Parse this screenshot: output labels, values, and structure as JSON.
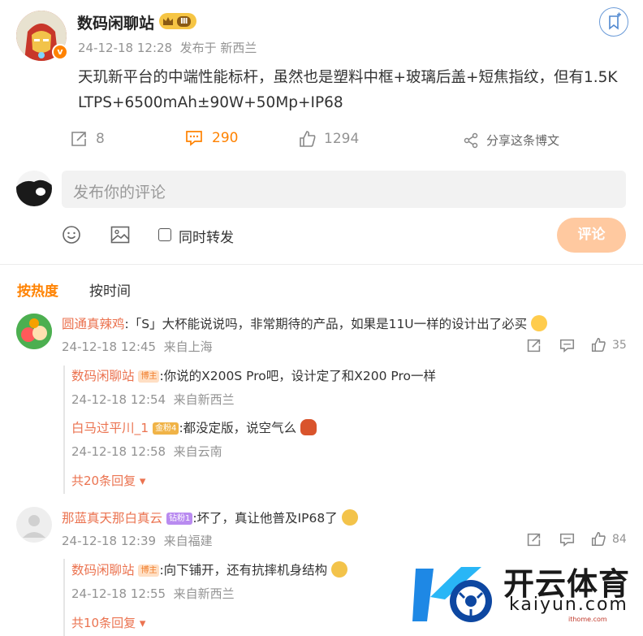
{
  "post": {
    "author": "数码闲聊站",
    "level_badge": "Ⅲ",
    "verified_mark": "v",
    "time": "24-12-18 12:28",
    "source": "发布于 新西兰",
    "content_line1": "天玑新平台的中端性能标杆，虽然也是塑料中框+玻璃后盖+短焦指纹，但有1.5K",
    "content_line2": "LTPS+6500mAh±90W+50Mp+IP68",
    "repost_count": "8",
    "comment_count": "290",
    "like_count": "1294",
    "share_label": "分享这条博文"
  },
  "composer": {
    "placeholder": "发布你的评论",
    "repost_label": "同时转发",
    "submit_label": "评论"
  },
  "sort_tabs": {
    "hot": "按热度",
    "time": "按时间"
  },
  "comments": [
    {
      "user": "圆通真辣鸡",
      "text": ":「S」大杯能说说吗，非常期待的产品，如果是11U一样的设计出了必买",
      "time": "24-12-18 12:45",
      "location": "来自上海",
      "likes": "35",
      "replies": [
        {
          "user": "数码闲聊站",
          "tag": "博主",
          "text": ":你说的X200S Pro吧，设计定了和X200 Pro一样",
          "time": "24-12-18 12:54",
          "location": "来自新西兰"
        },
        {
          "user": "白马过平川_1",
          "tag": "金粉4",
          "text": ":都没定版，说空气么",
          "time": "24-12-18 12:58",
          "location": "来自云南"
        }
      ],
      "more": "共20条回复"
    },
    {
      "user": "那蓝真天那白真云",
      "tag": "钻粉1",
      "text": ":坏了，真让他普及IP68了",
      "time": "24-12-18 12:39",
      "location": "来自福建",
      "likes": "84",
      "replies": [
        {
          "user": "数码闲聊站",
          "tag": "博主",
          "text": ":向下铺开，还有抗摔机身结构",
          "time": "24-12-18 12:55",
          "location": "来自新西兰"
        }
      ],
      "more": "共10条回复"
    }
  ],
  "watermark": {
    "brand": "开云体育",
    "domain": "kaiyun.com",
    "small": "ithome.com"
  },
  "colors": {
    "accent": "#ff8200",
    "link": "#eb7350",
    "muted": "#939393"
  }
}
